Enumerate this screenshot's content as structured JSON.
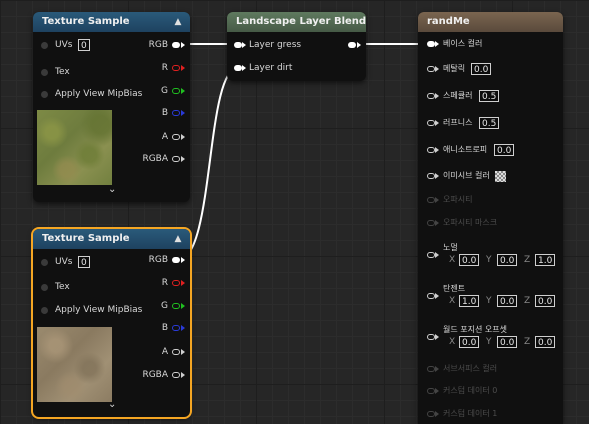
{
  "nodes": {
    "tex1": {
      "title": "Texture Sample",
      "inputs": {
        "uvs_label": "UVs",
        "uvs_value": "0",
        "tex_label": "Tex",
        "mip_label": "Apply View MipBias"
      },
      "outputs": [
        "RGB",
        "R",
        "G",
        "B",
        "A",
        "RGBA"
      ]
    },
    "tex2": {
      "title": "Texture Sample",
      "inputs": {
        "uvs_label": "UVs",
        "uvs_value": "0",
        "tex_label": "Tex",
        "mip_label": "Apply View MipBias"
      },
      "outputs": [
        "RGB",
        "R",
        "G",
        "B",
        "A",
        "RGBA"
      ]
    },
    "blend": {
      "title": "Landscape Layer Blend",
      "inputs": [
        "Layer gress",
        "Layer dirt"
      ]
    },
    "material": {
      "title": "randMe",
      "pins": {
        "base_color": "베이스 컬러",
        "metallic": "메탈릭",
        "metallic_value": "0.0",
        "specular": "스페큘러",
        "specular_value": "0.5",
        "roughness": "러프니스",
        "roughness_value": "0.5",
        "anisotropy": "애니소트로피",
        "anisotropy_value": "0.0",
        "emissive": "이미시브 컬러",
        "opacity": "오파시티",
        "opacity_mask": "오파시티 마스크",
        "normal": "노멀",
        "normal_x": "0.0",
        "normal_y": "0.0",
        "normal_z": "1.0",
        "tangent": "탄젠트",
        "tangent_x": "1.0",
        "tangent_y": "0.0",
        "tangent_z": "0.0",
        "wpo": "월드 포지션 오프셋",
        "wpo_x": "0.0",
        "wpo_y": "0.0",
        "wpo_z": "0.0",
        "subsurface": "서브서피스 컬러",
        "custom0": "커스텀 데이터 0",
        "custom1": "커스텀 데이터 1"
      },
      "axis_labels": [
        "X",
        "Y",
        "Z"
      ]
    }
  },
  "colors": {
    "selection": "#f5a623",
    "r_pin": "#e02020",
    "g_pin": "#20c020",
    "b_pin": "#2a3ad8",
    "wire": "#ffffff"
  }
}
